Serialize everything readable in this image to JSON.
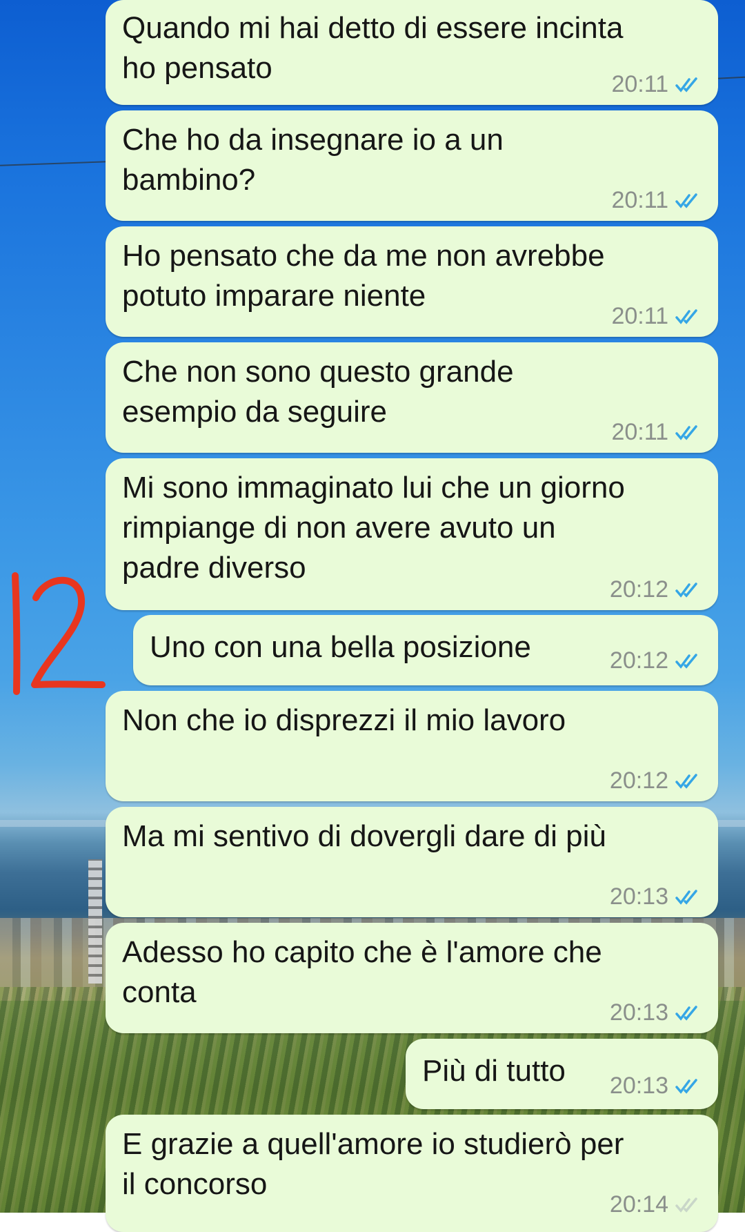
{
  "messages": [
    {
      "text": "Quando mi hai detto di essere incinta\nho pensato",
      "time": "20:11"
    },
    {
      "text": "Che ho da insegnare io a un\nbambino?",
      "time": "20:11"
    },
    {
      "text": "Ho pensato che da me non avrebbe\npotuto imparare niente",
      "time": "20:11"
    },
    {
      "text": "Che non sono questo grande\nesempio da seguire",
      "time": "20:11"
    },
    {
      "text": "Mi sono immaginato lui che un giorno\nrimpiange di non avere avuto un\npadre diverso",
      "time": "20:12"
    },
    {
      "text": "Uno con una bella posizione",
      "time": "20:12"
    },
    {
      "text": "Non che io disprezzi il mio lavoro",
      "time": "20:12"
    },
    {
      "text": "Ma mi sentivo di dovergli dare di più",
      "time": "20:13"
    },
    {
      "text": "Adesso ho capito che è l'amore che\nconta",
      "time": "20:13"
    },
    {
      "text": "Più di tutto",
      "time": "20:13"
    },
    {
      "text": "E grazie a quell'amore io studierò per\nil concorso",
      "time": "20:14"
    }
  ],
  "annotation": {
    "label": "12",
    "color": "#e8361f"
  },
  "colors": {
    "bubble": "#e9fbd8",
    "read_ticks": "#35a6e6",
    "time": "#8a8f8b"
  },
  "icons": {
    "read_status": "double-check-icon"
  }
}
